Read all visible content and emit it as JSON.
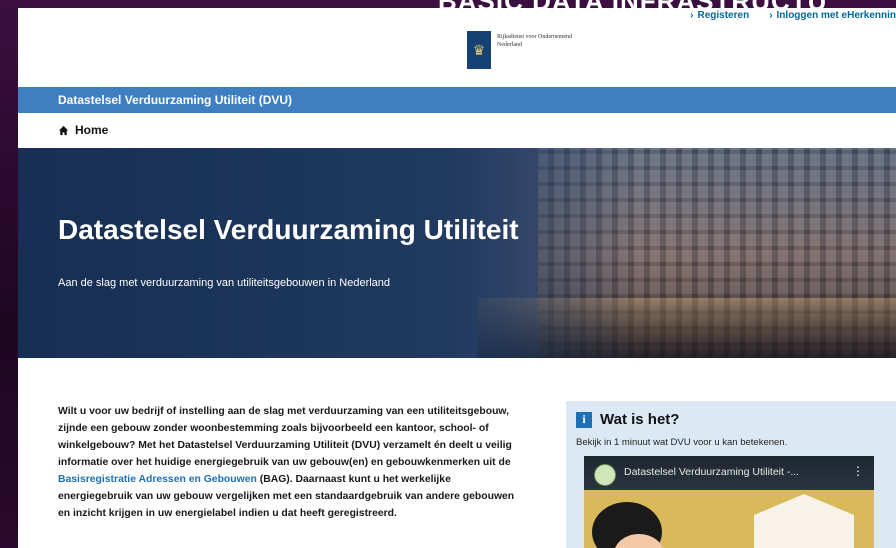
{
  "background": {
    "title": "BASIC DATA INFRASTRUCTU"
  },
  "top_links": [
    {
      "label": "Registeren"
    },
    {
      "label": "Inloggen met eHerkennin"
    }
  ],
  "logo": {
    "line1": "Rijksdienst voor Ondernemend",
    "line2": "Nederland",
    "icon": "crest-icon"
  },
  "nav": {
    "title": "Datastelsel Verduurzaming Utiliteit (DVU)",
    "color": "#3e7fc1"
  },
  "breadcrumb": {
    "home": "Home"
  },
  "hero": {
    "title": "Datastelsel Verduurzaming Utiliteit",
    "subtitle": "Aan de slag met verduurzaming van utiliteitsgebouwen in Nederland"
  },
  "intro": {
    "text_before": "Wilt u voor uw bedrijf of instelling aan de slag met verduurzaming van een utiliteitsgebouw, zijnde een gebouw zonder woonbestemming zoals bijvoorbeeld een kantoor, school- of winkelgebouw? Met het Datastelsel Verduurzaming Utiliteit (DVU) verzamelt én deelt u veilig informatie over het huidige energiegebruik van uw gebouw(en) en gebouwkenmerken uit de ",
    "link": "Basisregistratie Adressen en Gebouwen",
    "text_after": " (BAG). Daarnaast kunt u het werkelijke energiegebruik van uw gebouw vergelijken met een standaardgebruik van andere gebouwen en inzicht krijgen in uw energielabel indien u dat heeft geregistreerd."
  },
  "info_box": {
    "title": "Wat is het?",
    "description": "Bekijk in 1 minuut wat DVU voor u kan betekenen.",
    "video_title": "Datastelsel Verduurzaming Utiliteit -...",
    "accent": "#1f6fb5"
  }
}
